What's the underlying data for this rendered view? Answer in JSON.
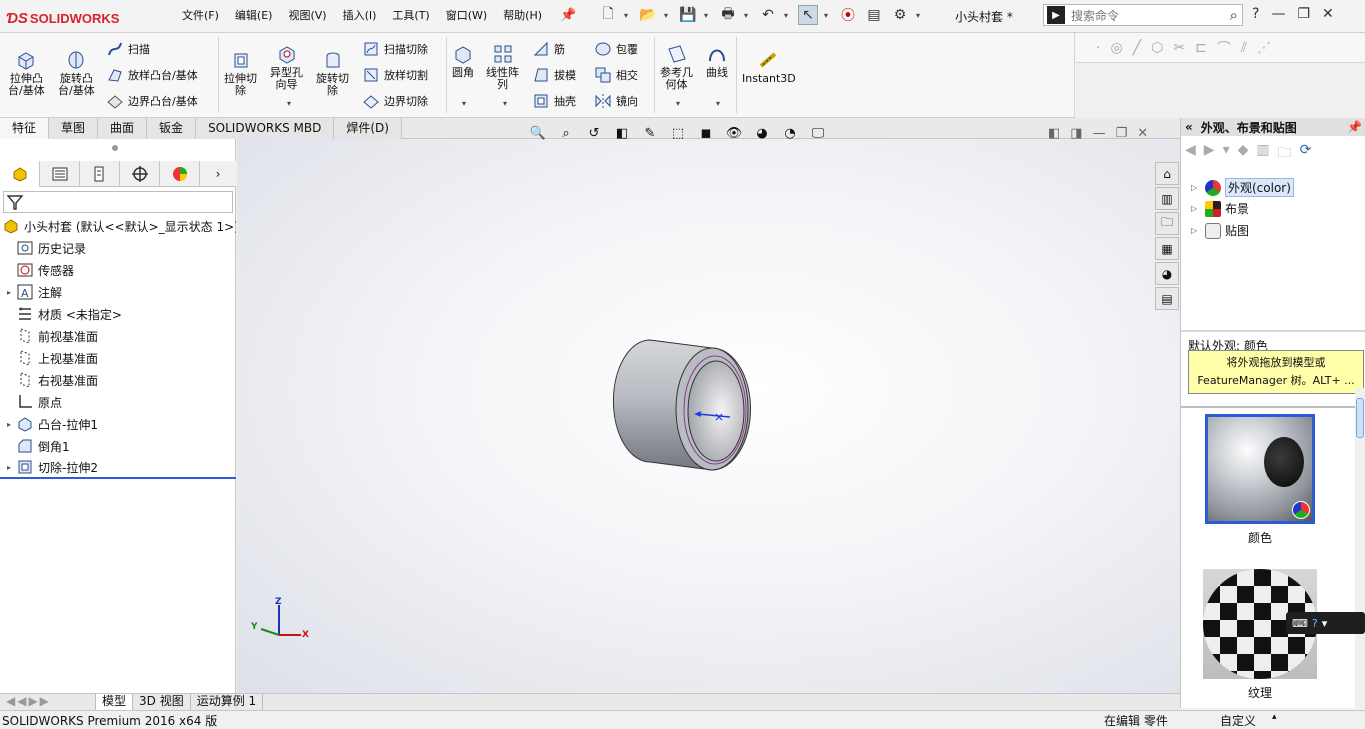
{
  "app": {
    "brand": "SOLIDWORKS",
    "document_title": "小头村套 *"
  },
  "menu": [
    "文件(F)",
    "编辑(E)",
    "视图(V)",
    "插入(I)",
    "工具(T)",
    "窗口(W)",
    "帮助(H)"
  ],
  "search": {
    "placeholder": "搜索命令"
  },
  "ribbon": {
    "extrude_boss": "拉伸凸\n台/基体",
    "revolve_boss": "旋转凸\n台/基体",
    "sweep": "扫描",
    "loft_boss": "放样凸台/基体",
    "boundary_boss": "边界凸台/基体",
    "extrude_cut": "拉伸切\n除",
    "hole_wizard": "异型孔\n向导",
    "revolve_cut": "旋转切\n除",
    "sweep_cut": "扫描切除",
    "loft_cut": "放样切割",
    "boundary_cut": "边界切除",
    "fillet": "圆角",
    "linear_pattern": "线性阵\n列",
    "rib": "筋",
    "draft": "拔模",
    "shell": "抽壳",
    "wrap": "包覆",
    "intersect": "相交",
    "mirror": "镜向",
    "ref_geometry": "参考几\n何体",
    "curves": "曲线",
    "instant3d": "Instant3D"
  },
  "tabs": [
    "特征",
    "草图",
    "曲面",
    "钣金",
    "SOLIDWORKS MBD",
    "焊件(D)"
  ],
  "feature_tree": {
    "root": "小头村套 (默认<<默认>_显示状态 1>)",
    "items": [
      {
        "label": "历史记录",
        "expandable": false,
        "icon": "history-icon"
      },
      {
        "label": "传感器",
        "expandable": false,
        "icon": "sensor-icon"
      },
      {
        "label": "注解",
        "expandable": true,
        "icon": "annotation-icon"
      },
      {
        "label": "材质 <未指定>",
        "expandable": false,
        "icon": "material-icon"
      },
      {
        "label": "前视基准面",
        "expandable": false,
        "icon": "plane-icon"
      },
      {
        "label": "上视基准面",
        "expandable": false,
        "icon": "plane-icon"
      },
      {
        "label": "右视基准面",
        "expandable": false,
        "icon": "plane-icon"
      },
      {
        "label": "原点",
        "expandable": false,
        "icon": "origin-icon"
      },
      {
        "label": "凸台-拉伸1",
        "expandable": true,
        "icon": "extrude-icon"
      },
      {
        "label": "倒角1",
        "expandable": false,
        "icon": "chamfer-icon"
      },
      {
        "label": "切除-拉伸2",
        "expandable": true,
        "icon": "cut-icon"
      }
    ]
  },
  "axes": {
    "x": "X",
    "y": "Y",
    "z": "Z"
  },
  "task_pane": {
    "title": "外观、布景和贴图",
    "items": [
      {
        "label": "外观(color)",
        "selected": true
      },
      {
        "label": "布景",
        "selected": false
      },
      {
        "label": "贴图",
        "selected": false
      }
    ],
    "default_label": "默认外观: 颜色",
    "tooltip_line1": "将外观拖放到模型或",
    "tooltip_line2": "FeatureManager 树。ALT+ ...",
    "swatch1_label": "颜色",
    "swatch2_label": "纹理"
  },
  "bottom_tabs": [
    "模型",
    "3D 视图",
    "运动算例 1"
  ],
  "status": {
    "left": "SOLIDWORKS Premium 2016 x64 版",
    "mid": "在编辑 零件",
    "right": "自定义"
  },
  "colors": {
    "accent_red": "#d8222a",
    "selection_blue": "#2d5bd6",
    "tooltip_yellow": "#ffffaa"
  }
}
